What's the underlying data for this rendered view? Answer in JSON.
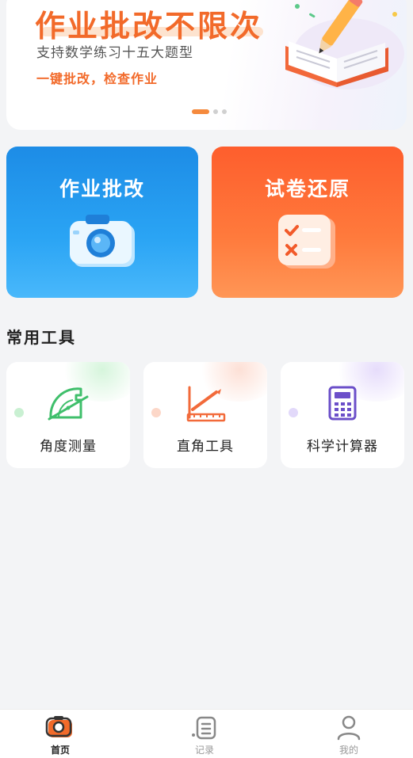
{
  "banner": {
    "title": "作业批改不限次",
    "subtitle": "支持数学练习十五大题型",
    "tagline": "一键批改，检查作业",
    "slide_count": 3,
    "active_slide": 1
  },
  "cards": [
    {
      "label": "作业批改",
      "icon": "camera-icon",
      "color": "#1d8ce6"
    },
    {
      "label": "试卷还原",
      "icon": "checklist-icon",
      "color": "#fe5e2d"
    }
  ],
  "tools_section": {
    "title": "常用工具",
    "items": [
      {
        "label": "角度测量",
        "icon": "protractor-icon"
      },
      {
        "label": "直角工具",
        "icon": "ruler-angle-icon"
      },
      {
        "label": "科学计算器",
        "icon": "calculator-icon"
      }
    ]
  },
  "nav": {
    "items": [
      {
        "label": "首页",
        "icon": "camera-home-icon",
        "active": true
      },
      {
        "label": "记录",
        "icon": "list-icon",
        "active": false
      },
      {
        "label": "我的",
        "icon": "person-icon",
        "active": false
      }
    ]
  }
}
